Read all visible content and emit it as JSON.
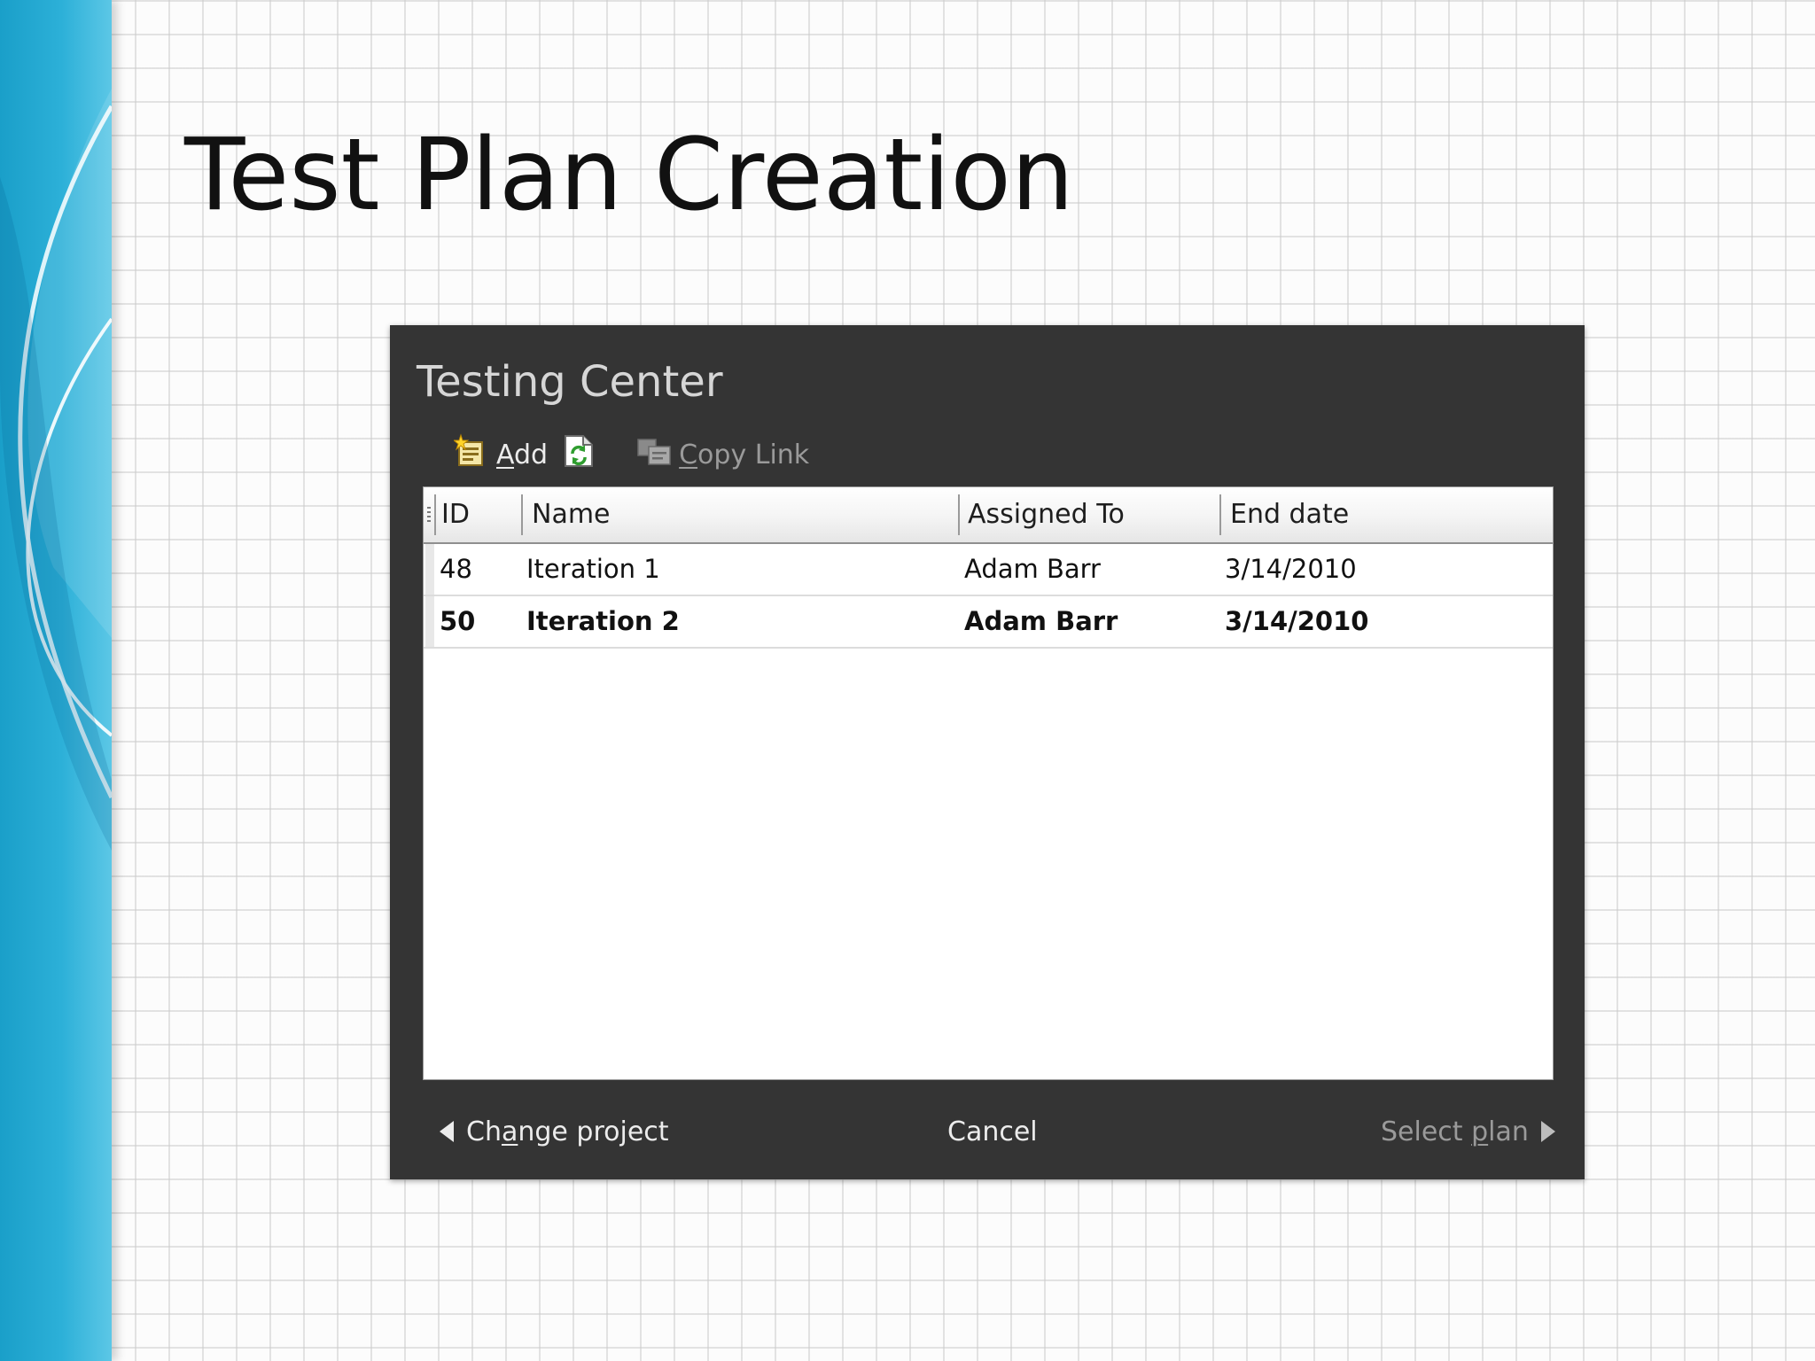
{
  "slide": {
    "title": "Test Plan Creation"
  },
  "dialog": {
    "title": "Testing Center",
    "toolbar": {
      "add_label": "Add",
      "add_access_key": "A",
      "add_rest": "dd",
      "refresh_icon": "refresh-icon",
      "copy_link_access_key": "C",
      "copy_link_rest": "opy Link"
    },
    "grid": {
      "columns": [
        "ID",
        "Name",
        "Assigned To",
        "End date"
      ],
      "rows": [
        {
          "id": "48",
          "name": "Iteration 1",
          "assigned_to": "Adam Barr",
          "end_date": "3/14/2010",
          "selected": false
        },
        {
          "id": "50",
          "name": "Iteration 2",
          "assigned_to": "Adam Barr",
          "end_date": "3/14/2010",
          "selected": true
        }
      ]
    },
    "footer": {
      "change_project_pre": "Ch",
      "change_project_key": "a",
      "change_project_post": "nge project",
      "cancel": "Cancel",
      "select_plan_pre": "Select ",
      "select_plan_key": "p",
      "select_plan_post": "lan"
    }
  },
  "colors": {
    "dialog_bg": "#343434",
    "band": "#2cb0d8",
    "grid_bg": "#ffffff"
  }
}
